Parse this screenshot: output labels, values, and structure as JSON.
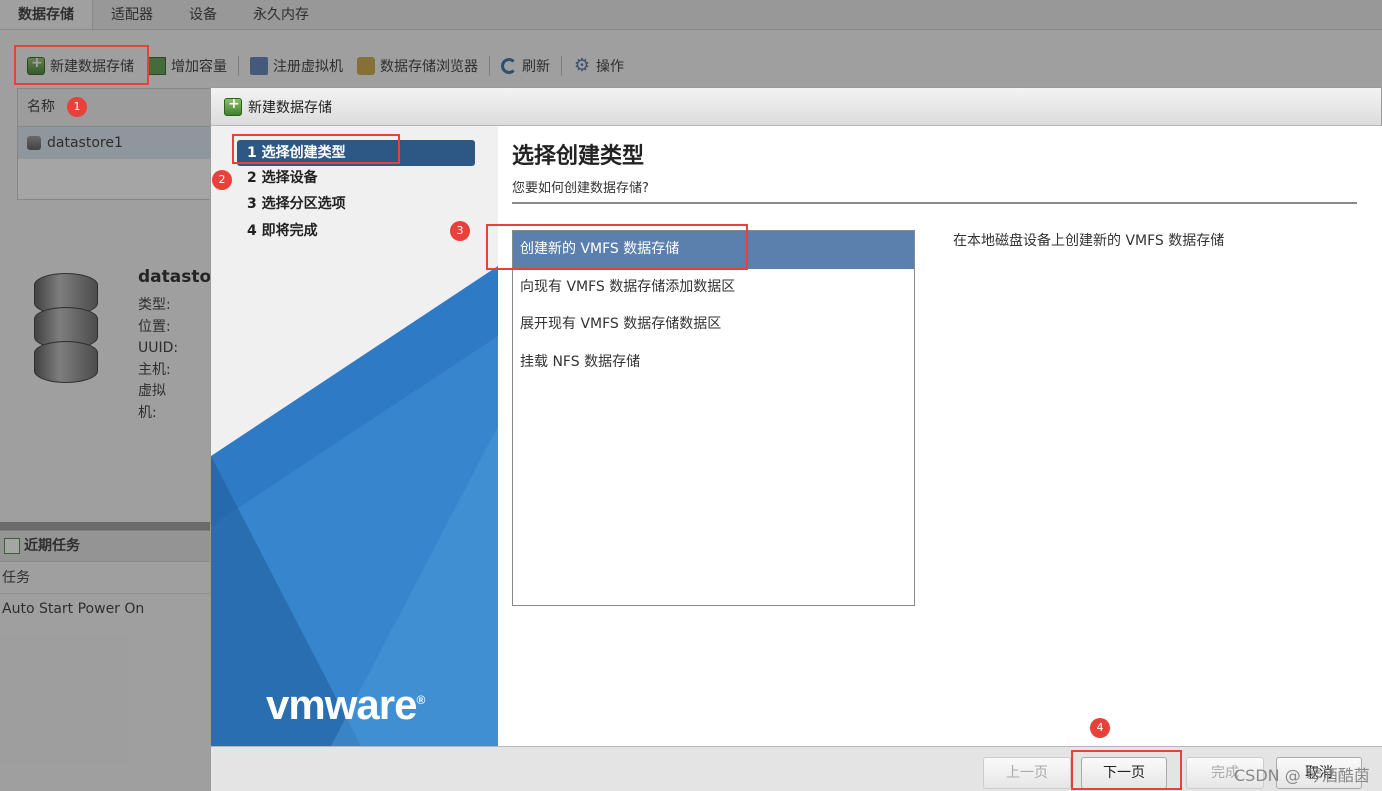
{
  "tabs": [
    "数据存储",
    "适配器",
    "设备",
    "永久内存"
  ],
  "toolbar": {
    "new_datastore": "新建数据存储",
    "increase_capacity": "增加容量",
    "register_vm": "注册虚拟机",
    "datastore_browser": "数据存储浏览器",
    "refresh": "刷新",
    "actions": "操作"
  },
  "list": {
    "header": "名称",
    "rows": [
      "datastore1"
    ]
  },
  "detail": {
    "name": "datastore",
    "props": [
      "类型:",
      "位置:",
      "UUID:",
      "主机:",
      "虚拟机:"
    ]
  },
  "tasks": {
    "title": "近期任务",
    "column": "任务",
    "rows": [
      "Auto Start Power On"
    ]
  },
  "dialog": {
    "title": "新建数据存储",
    "steps": [
      "1 选择创建类型",
      "2 选择设备",
      "3 选择分区选项",
      "4 即将完成"
    ],
    "heading": "选择创建类型",
    "subheading": "您要如何创建数据存储?",
    "options": [
      "创建新的 VMFS 数据存储",
      "向现有 VMFS 数据存储添加数据区",
      "展开现有 VMFS 数据存储数据区",
      "挂载 NFS 数据存储"
    ],
    "option_description": "在本地磁盘设备上创建新的 VMFS 数据存储",
    "logo": "vmware",
    "buttons": {
      "back": "上一页",
      "next": "下一页",
      "finish": "完成",
      "cancel": "取消"
    }
  },
  "annotations": [
    "1",
    "2",
    "3",
    "4"
  ],
  "watermark": "CSDN @ 琴酒酷茵",
  "colors": {
    "highlight": "#e8413a",
    "selected_step": "#2d5785",
    "selected_option": "#5b80ae",
    "vmware_blue": "#2f7ac4"
  }
}
